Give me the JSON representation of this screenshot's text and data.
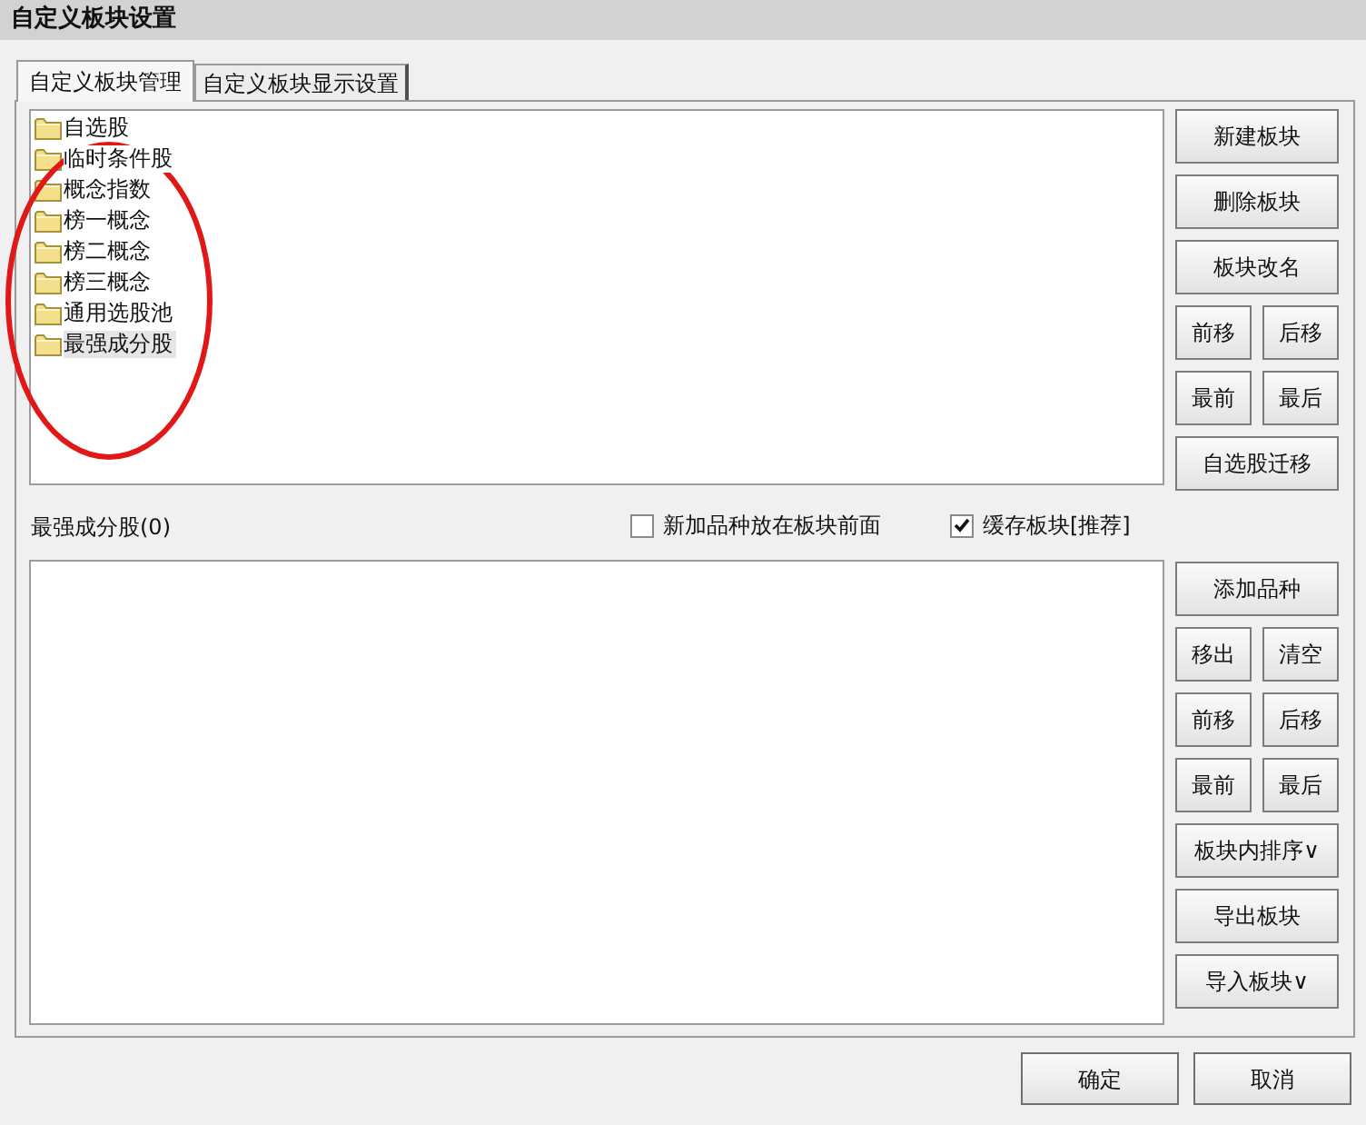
{
  "window": {
    "title": "自定义板块设置"
  },
  "tabs": [
    {
      "label": "自定义板块管理",
      "selected": true
    },
    {
      "label": "自定义板块显示设置",
      "selected": false
    }
  ],
  "block_list": {
    "items": [
      {
        "label": "自选股",
        "selected": false
      },
      {
        "label": "临时条件股",
        "selected": false
      },
      {
        "label": "概念指数",
        "selected": false
      },
      {
        "label": "榜一概念",
        "selected": false
      },
      {
        "label": "榜二概念",
        "selected": false
      },
      {
        "label": "榜三概念",
        "selected": false
      },
      {
        "label": "通用选股池",
        "selected": false
      },
      {
        "label": "最强成分股",
        "selected": true
      }
    ]
  },
  "block_buttons": [
    [
      "新建板块"
    ],
    [
      "删除板块"
    ],
    [
      "板块改名"
    ],
    [
      "前移",
      "后移"
    ],
    [
      "最前",
      "最后"
    ],
    [
      "自选股迁移"
    ]
  ],
  "member_panel": {
    "heading": "最强成分股(0)",
    "options": [
      {
        "label": "新加品种放在板块前面",
        "checked": false
      },
      {
        "label": "缓存板块[推荐]",
        "checked": true
      }
    ]
  },
  "member_buttons": [
    [
      "添加品种"
    ],
    [
      "移出",
      "清空"
    ],
    [
      "前移",
      "后移"
    ],
    [
      "最前",
      "最后"
    ],
    [
      "板块内排序∨"
    ],
    [
      "导出板块"
    ],
    [
      "导入板块∨"
    ]
  ],
  "footer_buttons": [
    "确定",
    "取消"
  ]
}
